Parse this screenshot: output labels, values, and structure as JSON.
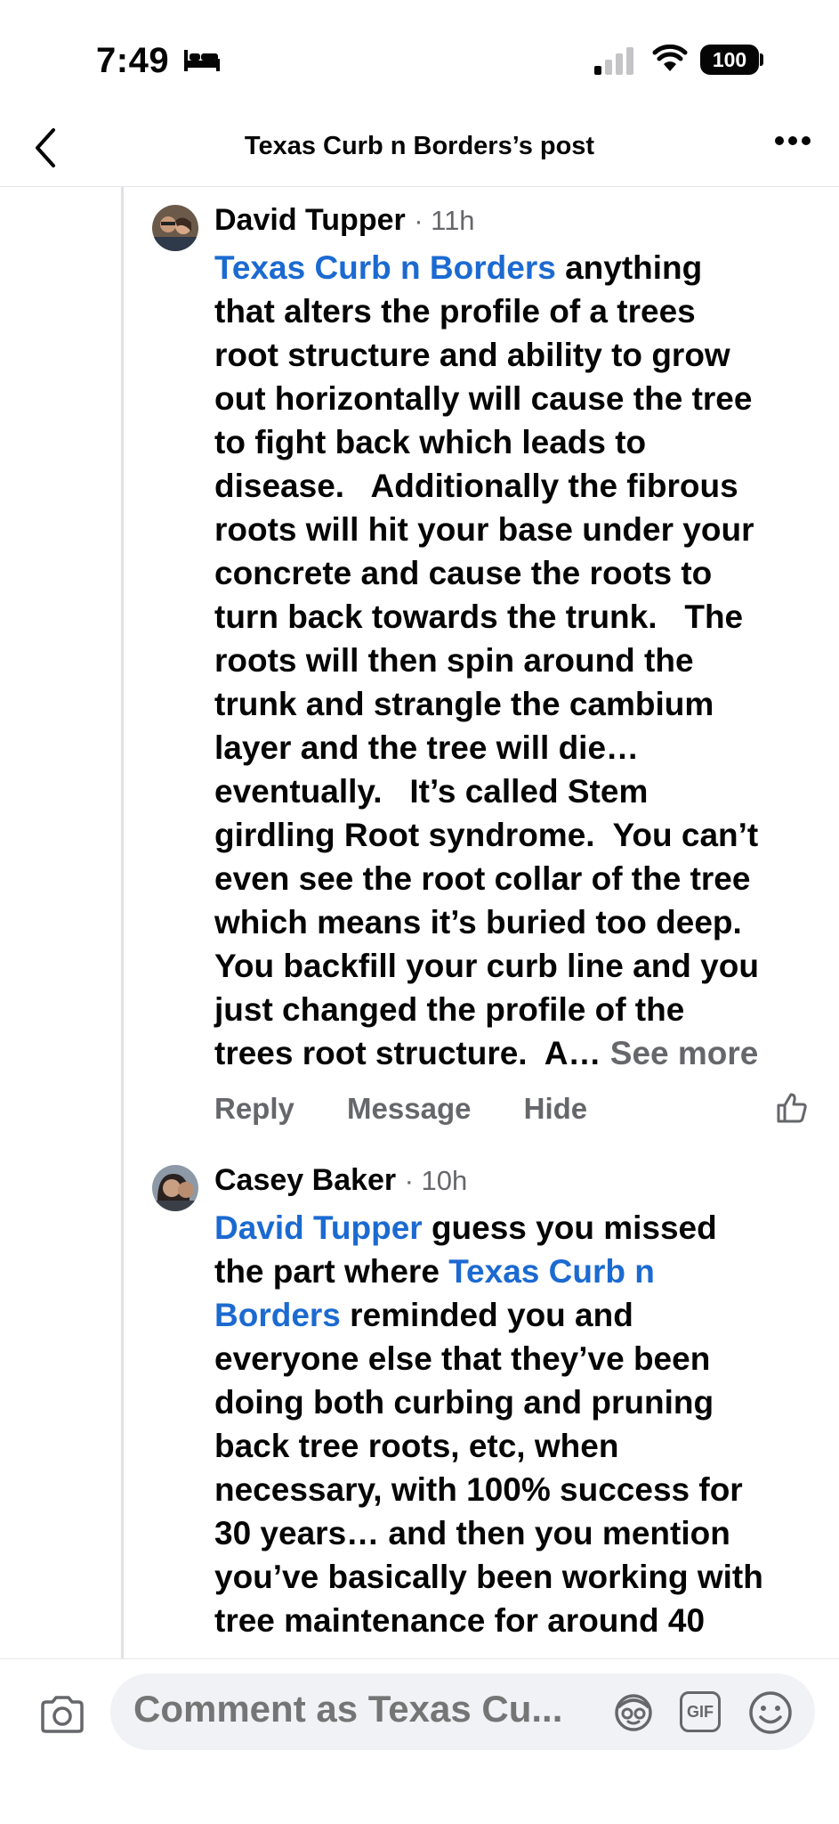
{
  "status_bar": {
    "time": "7:49",
    "battery": "100",
    "icons": [
      "bed-icon",
      "signal-icon",
      "wifi-icon",
      "battery-icon"
    ]
  },
  "nav": {
    "title": "Texas Curb n Borders’s post",
    "icons": [
      "back-icon",
      "more-icon"
    ]
  },
  "comments": [
    {
      "name": "David Tupper",
      "time": "· 11h",
      "body_lines": [
        {
          "mention": "Texas Curb n Borders",
          "text": " anything"
        },
        {
          "text": "that alters the profile of a trees"
        },
        {
          "text": "root structure and ability to grow"
        },
        {
          "text": "out horizontally will cause the tree"
        },
        {
          "text": "to fight back which leads to"
        },
        {
          "text": "disease.   Additionally the fibrous"
        },
        {
          "text": "roots will hit your base under your"
        },
        {
          "text": "concrete and cause the roots to"
        },
        {
          "text": "turn back towards the trunk.   The"
        },
        {
          "text": "roots will then spin around the"
        },
        {
          "text": "trunk and strangle the cambium"
        },
        {
          "text": "layer and the tree will die…"
        },
        {
          "text": "eventually.   It’s called Stem"
        },
        {
          "text": "girdling Root syndrome.  You can’t"
        },
        {
          "text": "even see the root collar of the tree"
        },
        {
          "text": "which means it’s buried too deep."
        },
        {
          "text": "You backfill your curb line and you"
        },
        {
          "text": "just changed the profile of the"
        },
        {
          "text": "trees root structure.  A… ",
          "more": "See more"
        }
      ],
      "actions": [
        "Reply",
        "Message",
        "Hide"
      ]
    },
    {
      "name": "Casey Baker",
      "time": "· 10h",
      "body_lines": [
        {
          "mention": "David Tupper",
          "text": " guess you missed"
        },
        {
          "text": "the part where ",
          "mention2": "Texas Curb n"
        },
        {
          "mention": "Borders",
          "text": " reminded you and"
        },
        {
          "text": "everyone else that they’ve been"
        },
        {
          "text": "doing both curbing and pruning"
        },
        {
          "text": "back tree roots, etc, when"
        },
        {
          "text": "necessary, with 100% success for"
        },
        {
          "text": "30 years… and then you mention"
        },
        {
          "text": "you’ve basically been working with"
        },
        {
          "text": "tree maintenance for around 40"
        }
      ]
    }
  ],
  "composer": {
    "placeholder": "Comment as Texas Cu...",
    "icons": [
      "camera-icon",
      "avatar-sticker-icon",
      "gif-icon",
      "emoji-icon"
    ],
    "gif_label": "GIF"
  },
  "colors": {
    "mention": "#1b6ad1",
    "muted": "#65676b",
    "text": "#050505",
    "input_bg": "#f0f2f5"
  }
}
